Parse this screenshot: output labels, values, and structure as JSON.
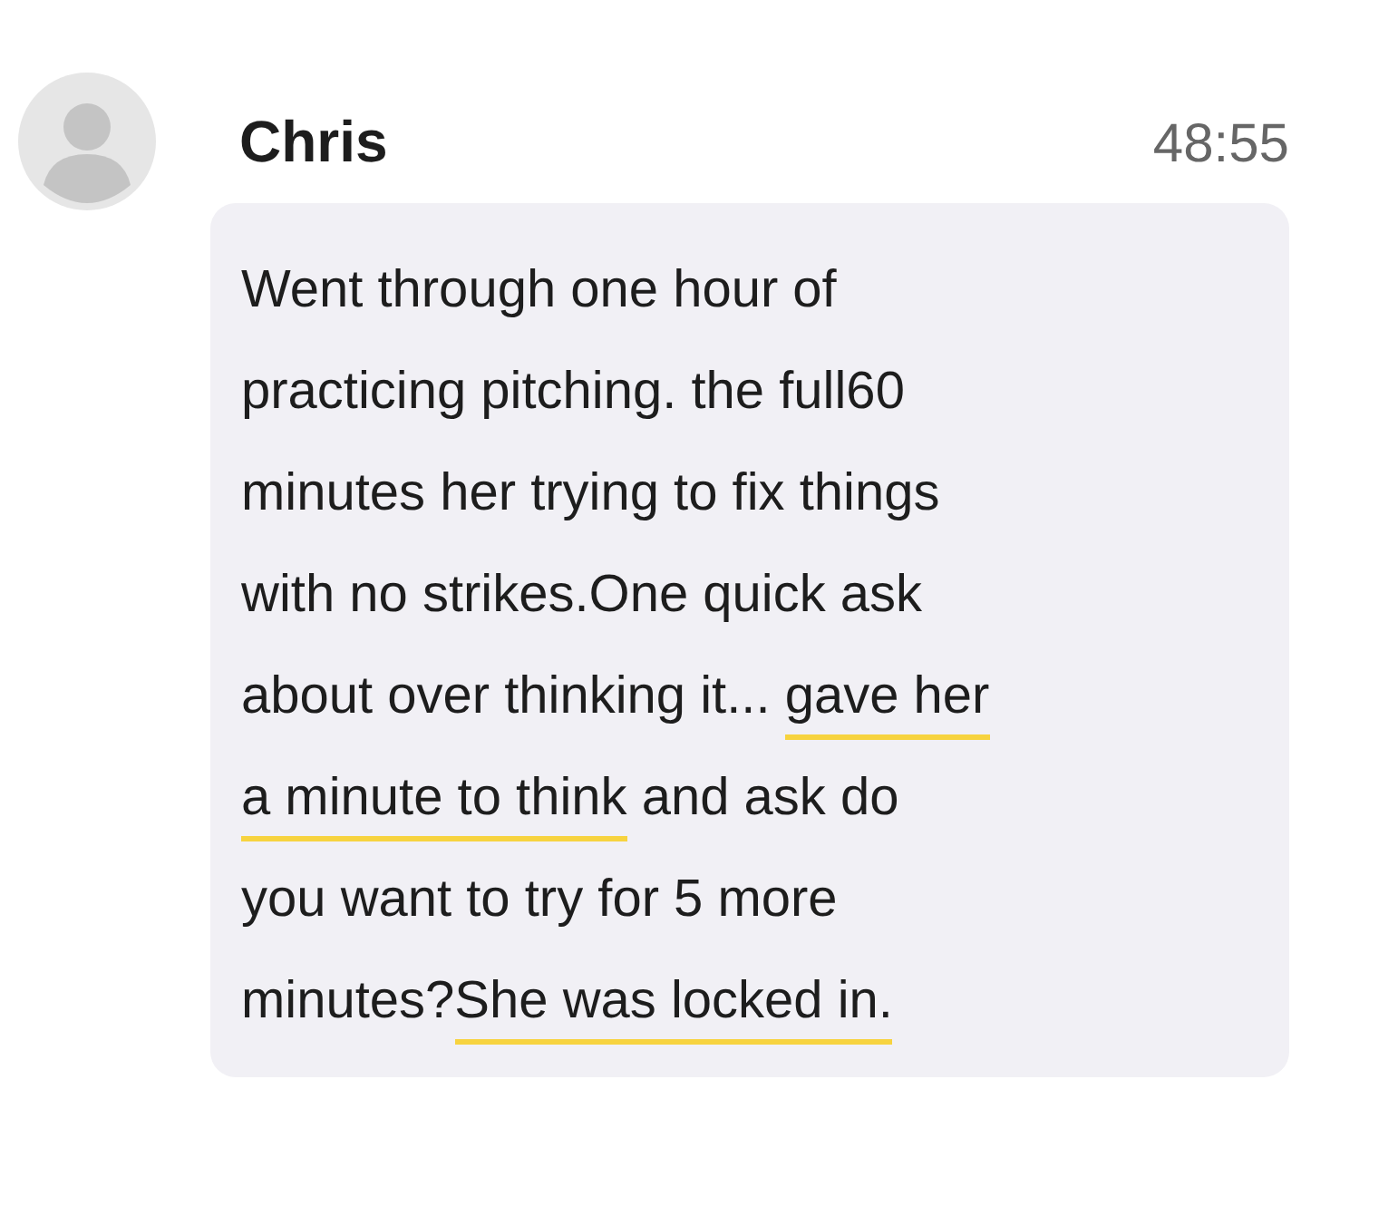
{
  "message": {
    "sender": "Chris",
    "time": "48:55",
    "lines": [
      [
        {
          "text": "Went through one hour of",
          "highlighted": false
        }
      ],
      [
        {
          "text": "practicing pitching. the full60",
          "highlighted": false
        }
      ],
      [
        {
          "text": "minutes her trying to fix things",
          "highlighted": false
        }
      ],
      [
        {
          "text": "with no strikes.One quick ask",
          "highlighted": false
        }
      ],
      [
        {
          "text": "about over thinking it... ",
          "highlighted": false
        },
        {
          "text": "gave her",
          "highlighted": true
        }
      ],
      [
        {
          "text": "a minute to think",
          "highlighted": true
        },
        {
          "text": " and ask do",
          "highlighted": false
        }
      ],
      [
        {
          "text": "you want to try for 5 more",
          "highlighted": false
        }
      ],
      [
        {
          "text": "minutes?",
          "highlighted": false
        },
        {
          "text": "She was locked in.",
          "highlighted": true
        }
      ]
    ]
  }
}
